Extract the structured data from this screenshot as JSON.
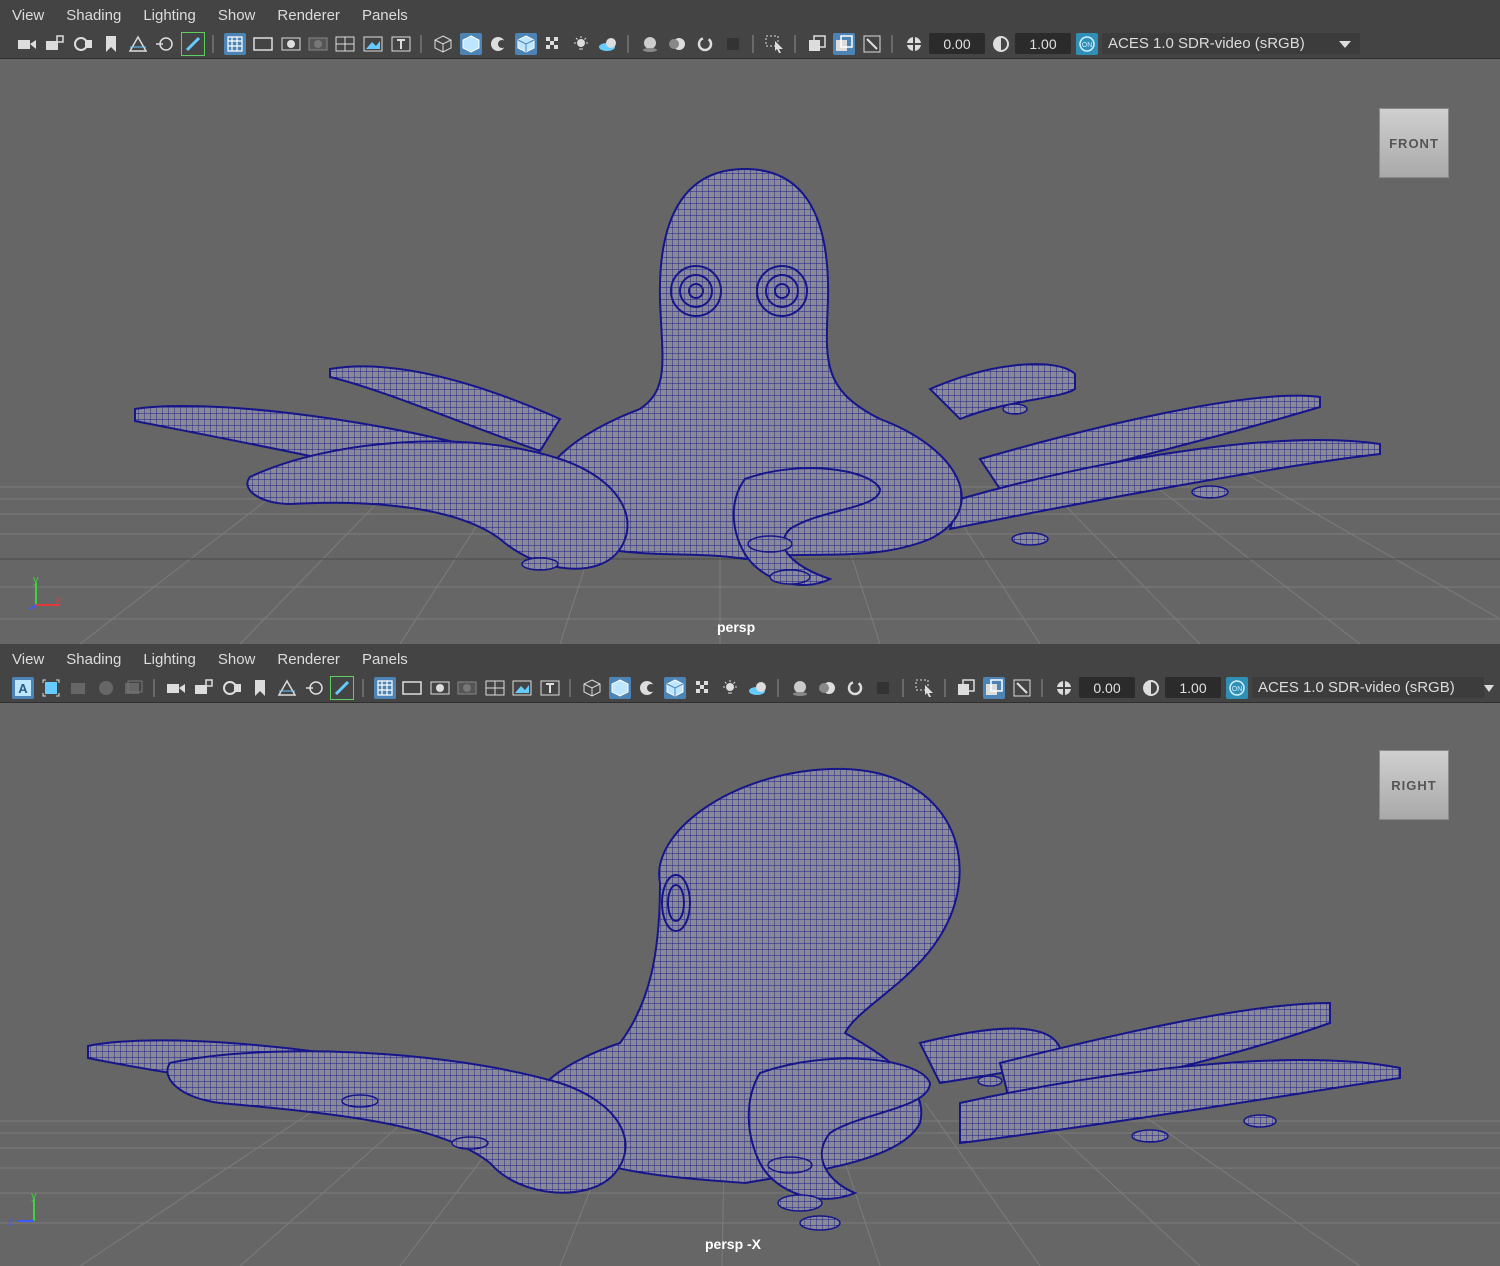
{
  "top_panel": {
    "menus": [
      "View",
      "Shading",
      "Lighting",
      "Show",
      "Renderer",
      "Panels"
    ],
    "exposure": "0.00",
    "gamma": "1.00",
    "color_management": "ACES 1.0 SDR-video (sRGB)",
    "view_cube": "FRONT",
    "camera_label": "persp"
  },
  "bottom_panel": {
    "menus": [
      "View",
      "Shading",
      "Lighting",
      "Show",
      "Renderer",
      "Panels"
    ],
    "exposure": "0.00",
    "gamma": "1.00",
    "color_management": "ACES 1.0 SDR-video (sRGB)",
    "view_cube": "RIGHT",
    "camera_label": "persp -X"
  },
  "axis_labels": {
    "y": "y",
    "x": "x",
    "z": "z"
  },
  "colors": {
    "viewport_bg": "#666666",
    "grid": "#7b7b7b",
    "mesh_fill": "#7e7e8a",
    "wireframe": "#1a1a8c",
    "toolbar_active": "#4d84b6"
  },
  "icons": [
    "camera-icon",
    "camera-lock-icon",
    "camera-attr-icon",
    "bookmark-icon",
    "image-plane-icon",
    "pan-zoom-icon",
    "grease-pencil-icon",
    "grid-icon",
    "film-gate-icon",
    "resolution-gate-icon",
    "gate-mask-icon",
    "field-chart-icon",
    "safe-action-icon",
    "safe-title-icon",
    "wireframe-icon",
    "smooth-shade-icon",
    "default-material-icon",
    "wireframe-on-shaded-icon",
    "textured-icon",
    "lights-icon",
    "shadows-icon",
    "ambient-occlusion-icon",
    "motion-blur-icon",
    "anti-alias-icon",
    "depth-of-field-icon",
    "isolate-select-icon",
    "xray-icon",
    "xray-joints-icon",
    "xray-components-icon",
    "exposure-icon",
    "gamma-icon",
    "color-management-icon",
    "dropdown-icon"
  ]
}
